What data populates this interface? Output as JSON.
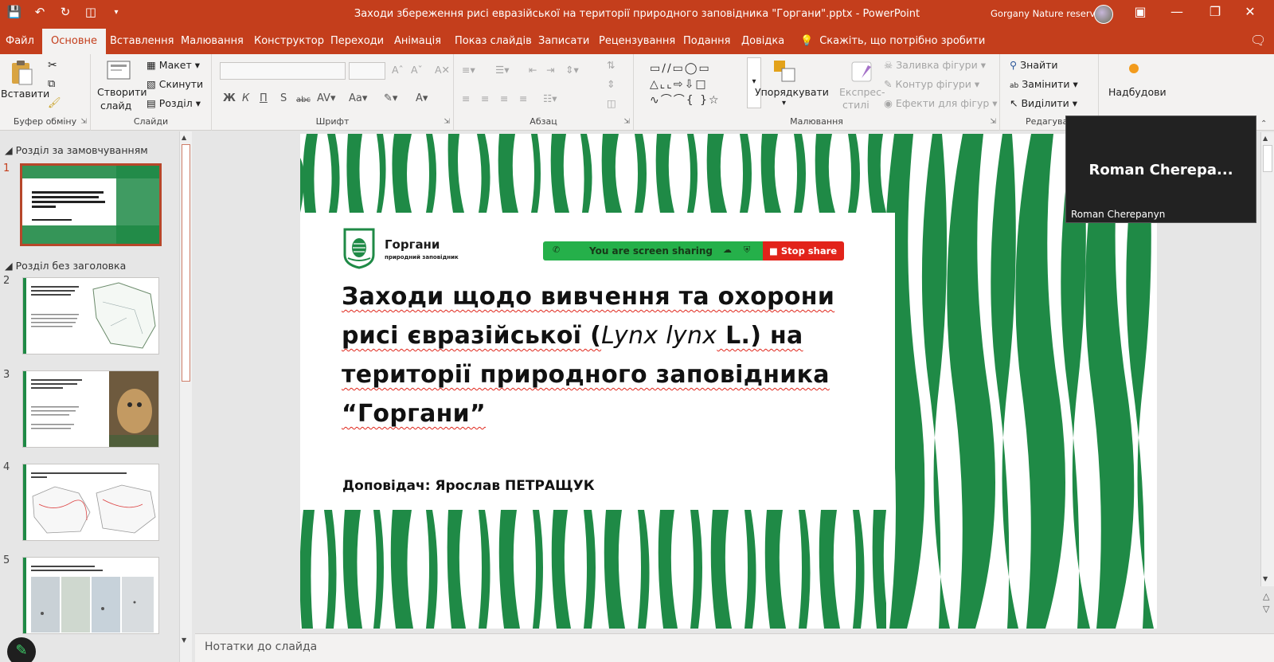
{
  "titlebar": {
    "doc_title": "Заходи збереження рисі евразійської на території природного заповідника \"Горгани\".pptx  -  PowerPoint",
    "account": "Gorgany Nature reserve"
  },
  "tabs": [
    {
      "label": "Файл"
    },
    {
      "label": "Основне"
    },
    {
      "label": "Вставлення"
    },
    {
      "label": "Малювання"
    },
    {
      "label": "Конструктор"
    },
    {
      "label": "Переходи"
    },
    {
      "label": "Анімація"
    },
    {
      "label": "Показ слайдів"
    },
    {
      "label": "Записати"
    },
    {
      "label": "Рецензування"
    },
    {
      "label": "Подання"
    },
    {
      "label": "Довідка"
    }
  ],
  "tell_me": "Скажіть, що потрібно зробити",
  "ribbon": {
    "clipboard": {
      "paste": "Вставити",
      "group": "Буфер обміну"
    },
    "slides": {
      "new_slide_1": "Створити",
      "new_slide_2": "слайд",
      "layout": "Макет",
      "reset": "Скинути",
      "section": "Розділ",
      "group": "Слайди"
    },
    "font": {
      "group": "Шрифт"
    },
    "paragraph": {
      "group": "Абзац"
    },
    "drawing": {
      "arrange": "Упорядкувати",
      "quick_styles_1": "Експрес-",
      "quick_styles_2": "стилі",
      "fill": "Заливка фігури",
      "outline": "Контур фігури",
      "effects": "Ефекти для фігур",
      "group": "Малювання"
    },
    "editing": {
      "find": "Знайти",
      "replace": "Замінити",
      "select": "Виділити",
      "group": "Редагуван"
    },
    "addins": {
      "label": "Надбудови"
    }
  },
  "thumbpane": {
    "section1": "Розділ за замовчуванням",
    "section2": "Розділ без заголовка",
    "slides": [
      {
        "num": "1"
      },
      {
        "num": "2"
      },
      {
        "num": "3"
      },
      {
        "num": "4"
      },
      {
        "num": "5"
      }
    ]
  },
  "slide": {
    "logo_name": "Горгани",
    "logo_sub": "природний заповідник",
    "title_line1": "Заходи щодо вивчення та охорони",
    "title_line2a": "рисі євразійської (",
    "title_latin": "Lynx lynx",
    "title_line2b": " L.) на",
    "title_line3": "території природного заповідника",
    "title_line4": "“Горгани”",
    "speaker": "Доповідач: Ярослав ПЕТРАЩУК",
    "green": "#1f8a46"
  },
  "share_banner": {
    "text": "You are screen sharing",
    "stop": "Stop share"
  },
  "video": {
    "display_name": "Roman  Cherepa...",
    "name_tag": "Roman Cherepanyn"
  },
  "notes": {
    "placeholder": "Нотатки до слайда"
  },
  "colors": {
    "accent": "#c43e1c",
    "share_green": "#25b04a",
    "share_red": "#e2231a"
  }
}
